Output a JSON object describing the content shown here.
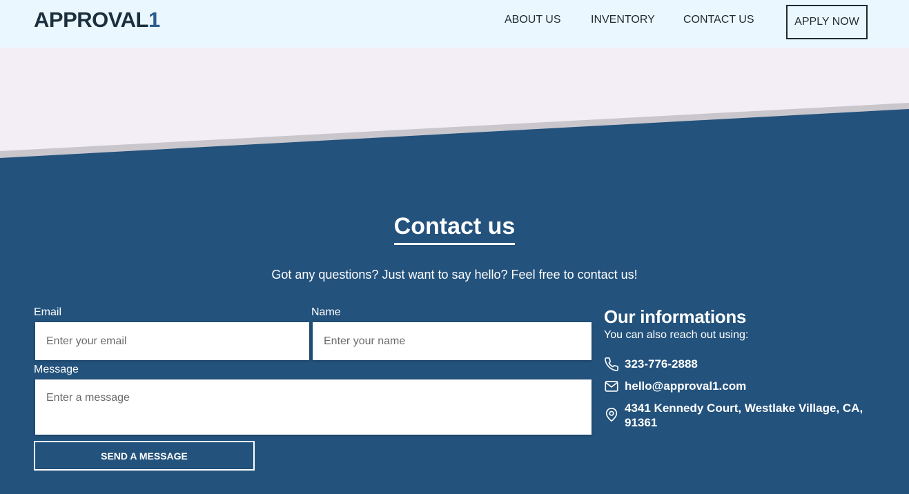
{
  "header": {
    "logo_text": "APPROVAL",
    "logo_accent": "1",
    "nav": [
      {
        "label": "ABOUT US"
      },
      {
        "label": "INVENTORY"
      },
      {
        "label": "CONTACT US"
      }
    ],
    "apply_label": "APPLY NOW"
  },
  "contact": {
    "title": "Contact us",
    "subtitle": "Got any questions? Just want to say hello? Feel free to contact us!",
    "form": {
      "email_label": "Email",
      "email_placeholder": "Enter your email",
      "name_label": "Name",
      "name_placeholder": "Enter your name",
      "message_label": "Message",
      "message_placeholder": "Enter a message",
      "send_label": "SEND A MESSAGE"
    },
    "info": {
      "title": "Our informations",
      "subtitle": "You can also reach out using:",
      "phone": "323-776-2888",
      "email": "hello@approval1.com",
      "address": "4341 Kennedy Court, Westlake Village, CA, 91361"
    }
  },
  "icons": {
    "phone": "phone-icon",
    "mail": "mail-icon",
    "location": "location-pin-icon"
  },
  "colors": {
    "header_bg": "#ebf7fe",
    "hero_bg": "#f3eef5",
    "section_bg": "#23527c",
    "logo_text": "#1c2f3d",
    "logo_accent": "#2a5d8f"
  }
}
